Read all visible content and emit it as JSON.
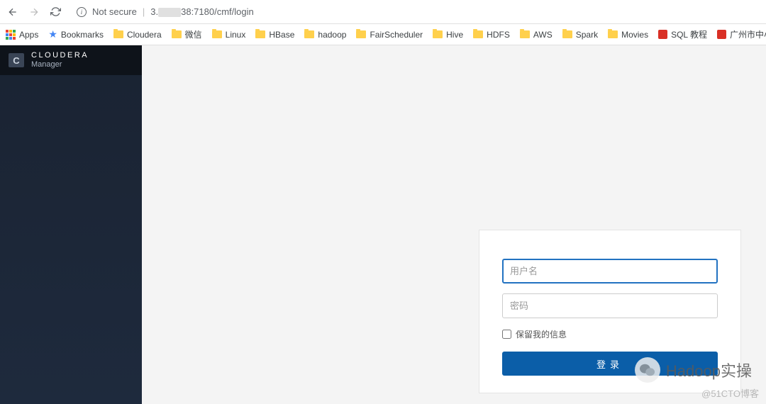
{
  "browser": {
    "not_secure": "Not secure",
    "url_prefix": "3.",
    "url_suffix": "38:7180/cmf/login"
  },
  "bookmarks": {
    "apps": "Apps",
    "bookmarks": "Bookmarks",
    "folders": [
      "Cloudera",
      "微信",
      "Linux",
      "HBase",
      "hadoop",
      "FairScheduler",
      "Hive",
      "HDFS",
      "AWS",
      "Spark",
      "Movies"
    ],
    "sql": "SQL 教程",
    "gz": "广州市中小客车指..."
  },
  "sidebar": {
    "logo_letter": "C",
    "brand": "CLOUDERA",
    "subtitle": "Manager"
  },
  "login": {
    "username_placeholder": "用户名",
    "password_placeholder": "密码",
    "remember_label": "保留我的信息",
    "submit_label": "登录"
  },
  "watermarks": {
    "bubble_text": "Hadoop实操",
    "corner_text": "@51CTO博客"
  }
}
